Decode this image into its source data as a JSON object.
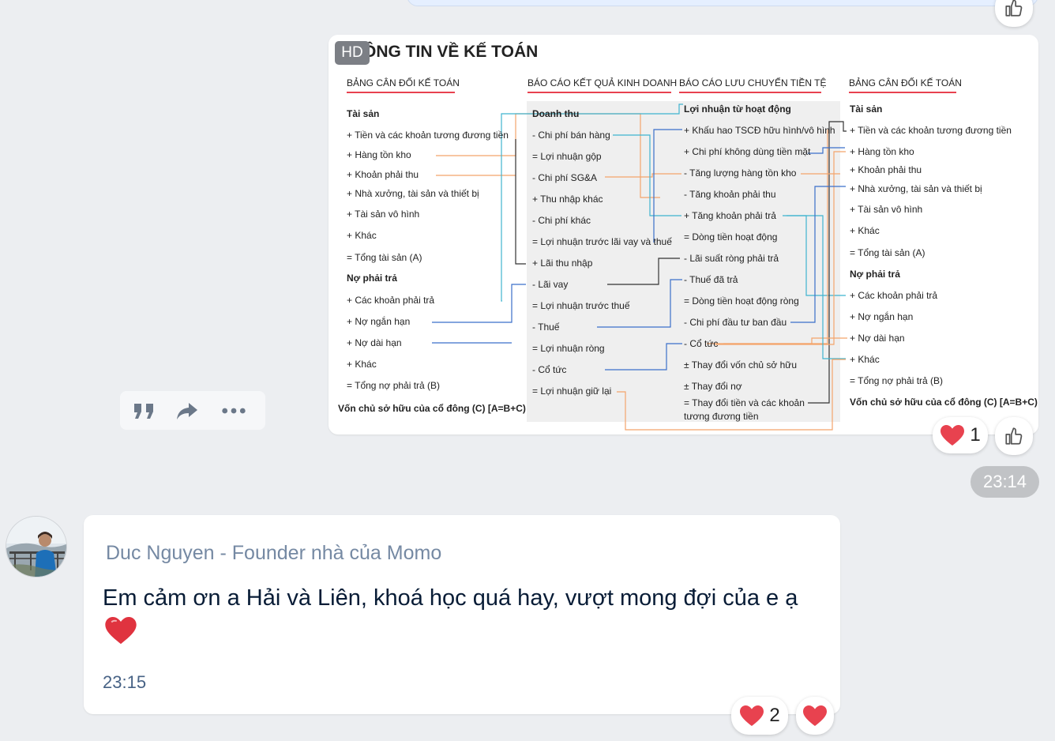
{
  "previous_message": {},
  "image_message": {
    "hd_badge": "HD",
    "diagram": {
      "title": "THÔNG TIN VỀ KẾ TOÁN",
      "col1": {
        "heading": "BẢNG CÂN ĐỐI KẾ TOÁN",
        "lines": [
          "Tài sản",
          "+ Tiền và các khoản tương đương tiền",
          "+ Hàng tồn kho",
          "+ Khoản phải thu",
          "+ Nhà xưởng, tài sản và thiết bị",
          "+ Tài sản vô hình",
          "+ Khác",
          "= Tổng tài sản (A)",
          "Nợ phải trả",
          "+ Các khoản phải trả",
          "+ Nợ ngắn hạn",
          "+ Nợ dài hạn",
          "+ Khác",
          "= Tổng nợ phải trả (B)",
          "Vốn chủ sở hữu của cổ đông (C) [A=B+C)"
        ]
      },
      "col2": {
        "heading": "BÁO CÁO KẾT QUẢ KINH DOANH",
        "lines": [
          "Doanh thu",
          "- Chi phí bán hàng",
          "= Lợi nhuận gộp",
          "- Chi phí SG&A",
          "+ Thu nhập khác",
          "- Chi phí khác",
          "= Lợi nhuận trước lãi vay và thuế",
          "+ Lãi thu nhập",
          "- Lãi vay",
          "= Lợi nhuận trước thuế",
          "- Thuế",
          "= Lợi nhuận ròng",
          "- Cổ tức",
          "= Lợi nhuận giữ lại"
        ]
      },
      "col3": {
        "heading": "BÁO CÁO LƯU CHUYỂN TIỀN TỆ",
        "lines": [
          "Lợi nhuận từ hoạt động",
          "+ Khấu hao TSCĐ hữu hình/vô hình",
          "+ Chi phí không dùng tiền mặt",
          "- Tăng lượng hàng tồn kho",
          "- Tăng khoản phải thu",
          "+ Tăng khoản phải trả",
          "= Dòng tiền hoạt động",
          "- Lãi suất ròng phải trả",
          "- Thuế đã trả",
          "= Dòng tiền hoạt động ròng",
          "- Chi phí đầu tư ban đầu",
          "- Cổ tức",
          "± Thay đổi vốn chủ sở hữu",
          "± Thay đổi nợ",
          "= Thay đổi tiền và các khoản",
          "tương đương tiền"
        ]
      },
      "col4": {
        "heading": "BẢNG CÂN ĐỐI KẾ TOÁN",
        "lines": [
          "Tài sản",
          "+ Tiền và các khoản tương đương tiền",
          "+ Hàng tồn kho",
          "+ Khoản phải thu",
          "+ Nhà xưởng, tài sản và thiết bị",
          "+ Tài sản vô hình",
          "+ Khác",
          "= Tổng tài sản (A)",
          "Nợ phải trả",
          "+ Các khoản phải trả",
          "+ Nợ ngắn hạn",
          "+ Nợ dài hạn",
          "+ Khác",
          "= Tổng nợ phải trả (B)",
          "Vốn chủ sở hữu của cổ đông (C) [A=B+C)"
        ]
      }
    },
    "reaction_count": "1",
    "reaction_icon": "heart-icon",
    "time": "23:14"
  },
  "action_bar": {
    "icons": [
      "quote-icon",
      "share-icon",
      "more-icon"
    ]
  },
  "text_message": {
    "sender": "Duc Nguyen - Founder nhà của Momo",
    "text": "Em cảm ơn a Hải và Liên, khoá học quá hay, vượt mong đợi của e ạ",
    "emoji": "❤️",
    "time": "23:15",
    "reaction_count": "2",
    "reaction_icon": "heart-icon"
  },
  "colors": {
    "background": "#eceef1",
    "bubble": "#ffffff",
    "accent_red": "#e8424f",
    "orange_line": "#f4a46b",
    "teal_line": "#3fb3cf",
    "blue_line": "#3b6fc9",
    "name": "#7589a3",
    "time_pill": "#c1c3c6"
  }
}
